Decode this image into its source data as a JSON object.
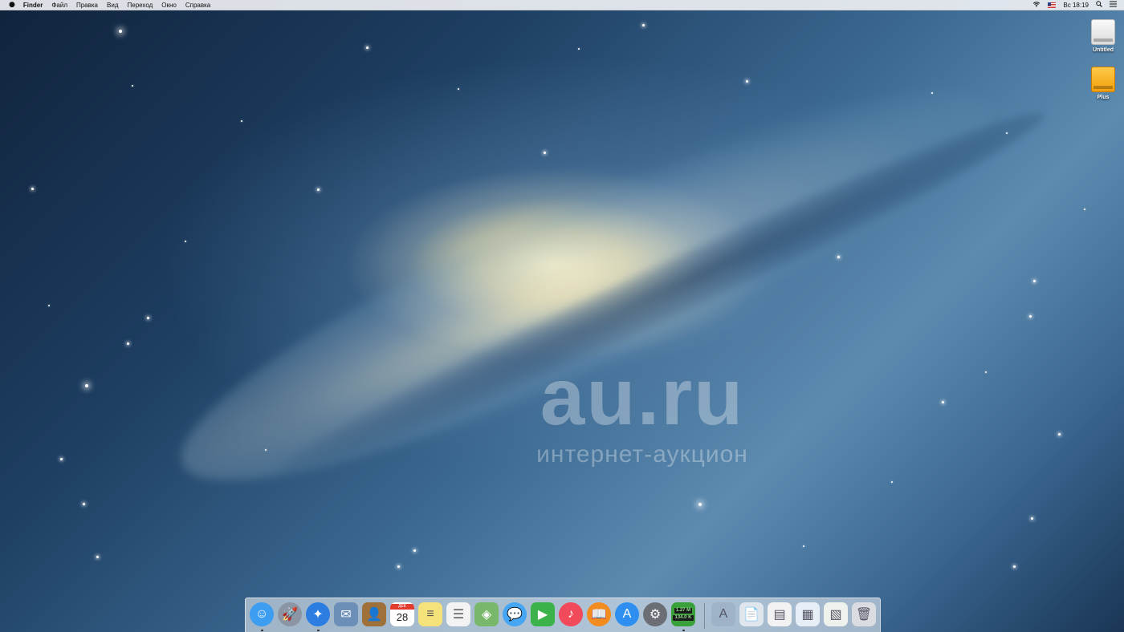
{
  "menubar": {
    "apple_icon": "apple-logo-icon",
    "app_name": "Finder",
    "menus": [
      "Файл",
      "Правка",
      "Вид",
      "Переход",
      "Окно",
      "Справка"
    ],
    "status": {
      "wifi_icon": "wifi-icon",
      "input_source_icon": "us-flag-icon",
      "clock": "Вс 18:19",
      "search_icon": "spotlight-search-icon",
      "notifications_icon": "notification-center-icon"
    }
  },
  "desktop": {
    "icons": [
      {
        "label": "Untitled",
        "icon": "hard-drive-icon"
      },
      {
        "label": "Plus",
        "icon": "external-drive-icon"
      }
    ],
    "watermark": {
      "big": "au.ru",
      "small": "интернет-аукцион"
    }
  },
  "dock": {
    "apps": [
      {
        "name": "finder-icon",
        "color": "#3d9df0",
        "glyph": "☺",
        "running": true
      },
      {
        "name": "launchpad-icon",
        "color": "#8c95a3",
        "glyph": "🚀",
        "running": false
      },
      {
        "name": "safari-icon",
        "color": "#2b7de1",
        "glyph": "✦",
        "running": true
      },
      {
        "name": "mail-icon",
        "color": "#6c8fb8",
        "glyph": "✉",
        "running": false
      },
      {
        "name": "contacts-icon",
        "color": "#a0703a",
        "glyph": "👤",
        "running": false
      },
      {
        "name": "calendar-icon",
        "color": "#ffffff",
        "glyph": "28",
        "month": "ДЕК",
        "running": false
      },
      {
        "name": "notes-icon",
        "color": "#f6e27a",
        "glyph": "≡",
        "running": false
      },
      {
        "name": "reminders-icon",
        "color": "#f3f3f3",
        "glyph": "☰",
        "running": false
      },
      {
        "name": "maps-icon",
        "color": "#79b86a",
        "glyph": "◈",
        "running": false
      },
      {
        "name": "messages-icon",
        "color": "#45a6f4",
        "glyph": "💬",
        "running": false
      },
      {
        "name": "facetime-icon",
        "color": "#3bb34a",
        "glyph": "▶",
        "running": false
      },
      {
        "name": "itunes-icon",
        "color": "#f04a5b",
        "glyph": "♪",
        "running": false
      },
      {
        "name": "ibooks-icon",
        "color": "#f28c1f",
        "glyph": "📖",
        "running": false
      },
      {
        "name": "app-store-icon",
        "color": "#2e8ff0",
        "glyph": "A",
        "running": false
      },
      {
        "name": "system-preferences-icon",
        "color": "#6b6f75",
        "glyph": "⚙",
        "running": false
      },
      {
        "name": "network-monitor-icon",
        "color": "#3aa03a",
        "upload": "1.27 M",
        "download": "134.0 K",
        "running": true
      }
    ],
    "stacks": [
      {
        "name": "applications-folder-icon",
        "color": "#9fb3c8",
        "glyph": "A"
      },
      {
        "name": "documents-stack-icon",
        "color": "#dfe6ee",
        "glyph": "📄"
      },
      {
        "name": "document-stack-icon-1",
        "color": "#f2f2f2",
        "glyph": "▤"
      },
      {
        "name": "document-stack-icon-2",
        "color": "#e8eef5",
        "glyph": "▦"
      },
      {
        "name": "downloads-stack-icon",
        "color": "#eef2ec",
        "glyph": "▧"
      },
      {
        "name": "trash-icon",
        "color": "#d9dde2",
        "glyph": "🗑"
      }
    ]
  }
}
